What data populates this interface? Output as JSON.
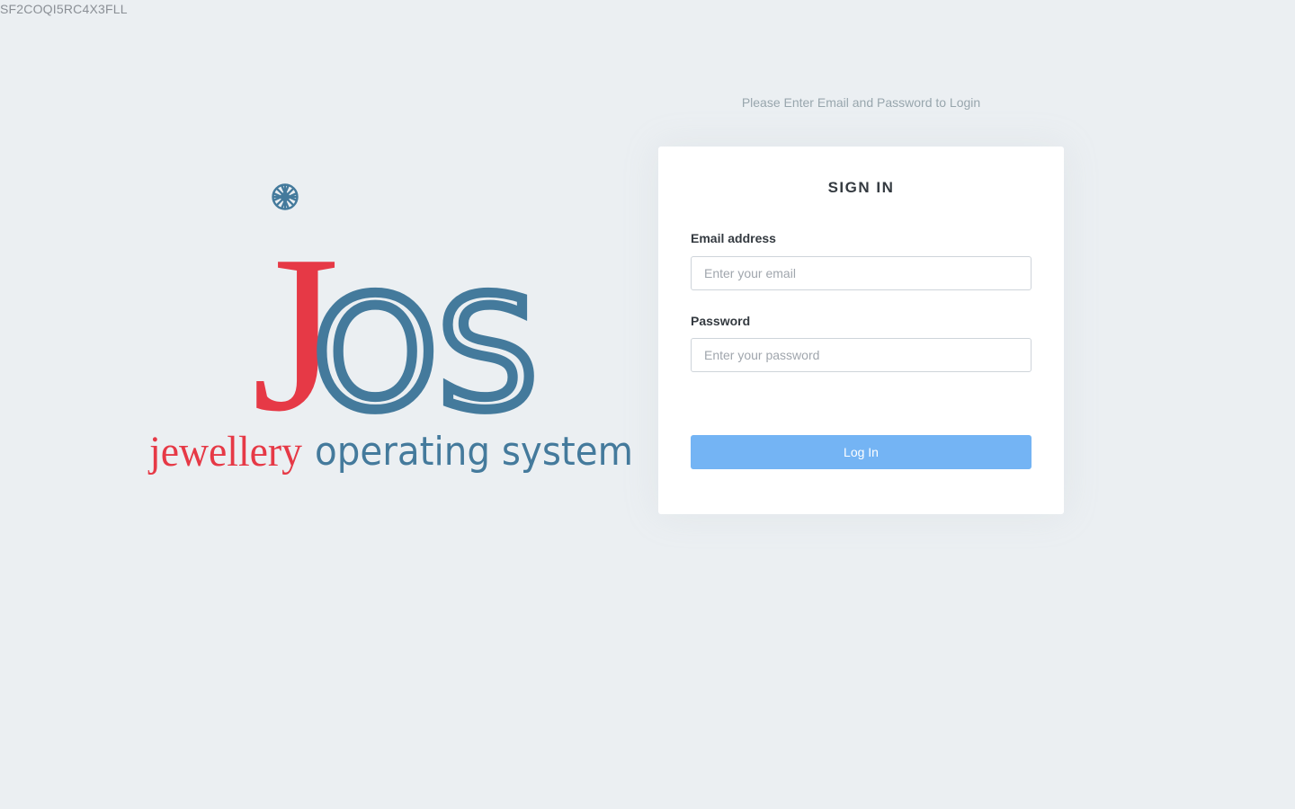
{
  "code": "SF2COQI5RC4X3FLL",
  "brand": {
    "wordmark_j": "J",
    "wordmark_os": "OS",
    "tagline_part1": "jewellery",
    "tagline_part2": "operating system",
    "icon": "jewel-icon",
    "colors": {
      "red": "#e63946",
      "blue": "#447a9c"
    }
  },
  "login": {
    "prompt": "Please Enter Email and Password to Login",
    "title": "SIGN IN",
    "email_label": "Email address",
    "email_placeholder": "Enter your email",
    "email_value": "",
    "password_label": "Password",
    "password_placeholder": "Enter your password",
    "password_value": "",
    "submit_label": "Log In",
    "button_color": "#74b4f4"
  }
}
